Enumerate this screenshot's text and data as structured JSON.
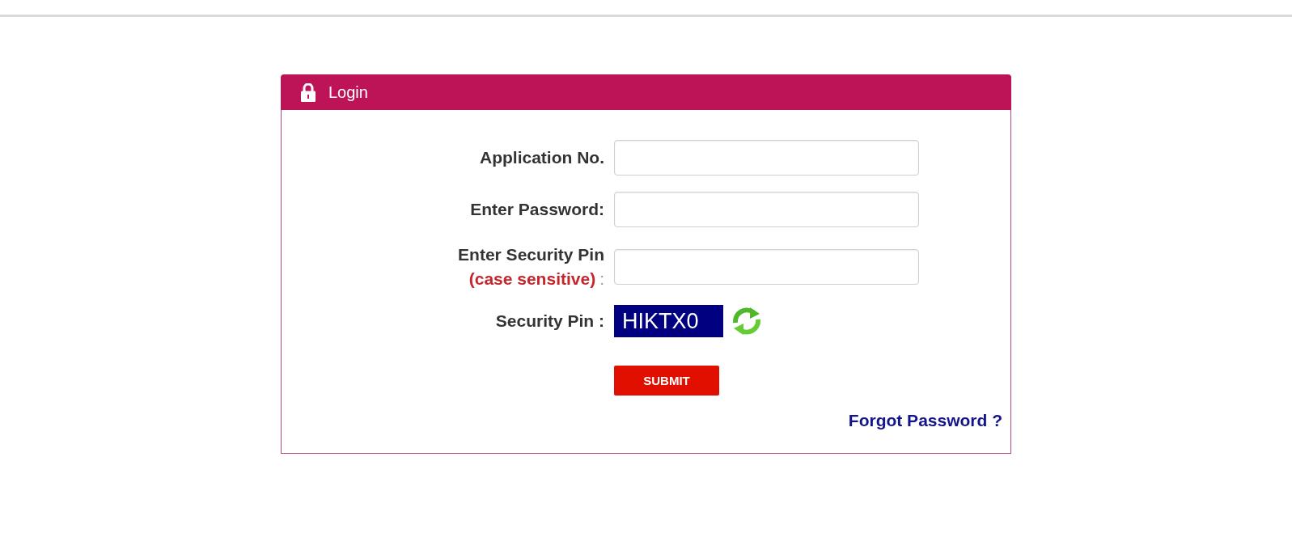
{
  "header": {
    "title": "Login"
  },
  "fields": [
    {
      "label": "Application No."
    },
    {
      "label": "Enter Password:"
    },
    {
      "label": "Enter Security Pin",
      "note": "(case sensitive)",
      "suffix": ":"
    }
  ],
  "captcha": {
    "label": "Security Pin :",
    "code": "HIKTX0"
  },
  "submit": {
    "label": "SUBMIT"
  },
  "forgot_link": {
    "text": "Forgot Password ?"
  }
}
